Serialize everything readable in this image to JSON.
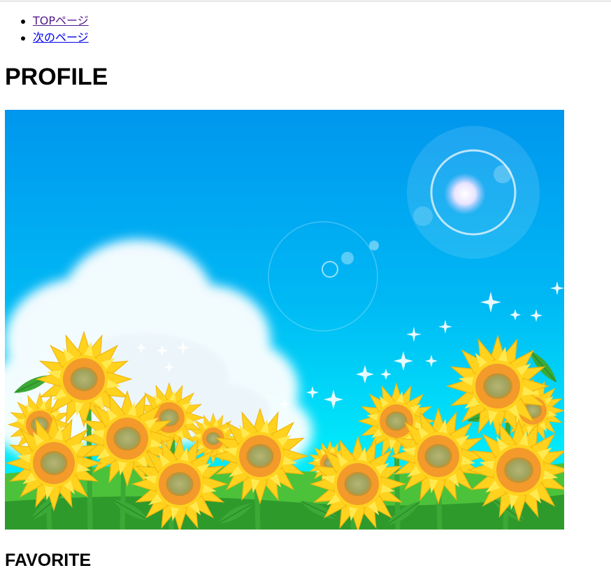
{
  "nav": {
    "items": [
      {
        "label": "TOPページ",
        "state": "visited"
      },
      {
        "label": "次のページ",
        "state": "link"
      }
    ]
  },
  "page": {
    "heading": "PROFILE",
    "subheading": "FAVORITE"
  },
  "hero_image": {
    "subject": "sunflower field under blue sky",
    "colors": {
      "sky_top": "#0098f0",
      "sky_bottom": "#00e6f8",
      "petal": "#ffd21e",
      "petal_light": "#ffee66",
      "disc": "#f39a2b",
      "center": "#a9a865",
      "leaf": "#3ba936",
      "grass": "#4cc23a"
    }
  }
}
